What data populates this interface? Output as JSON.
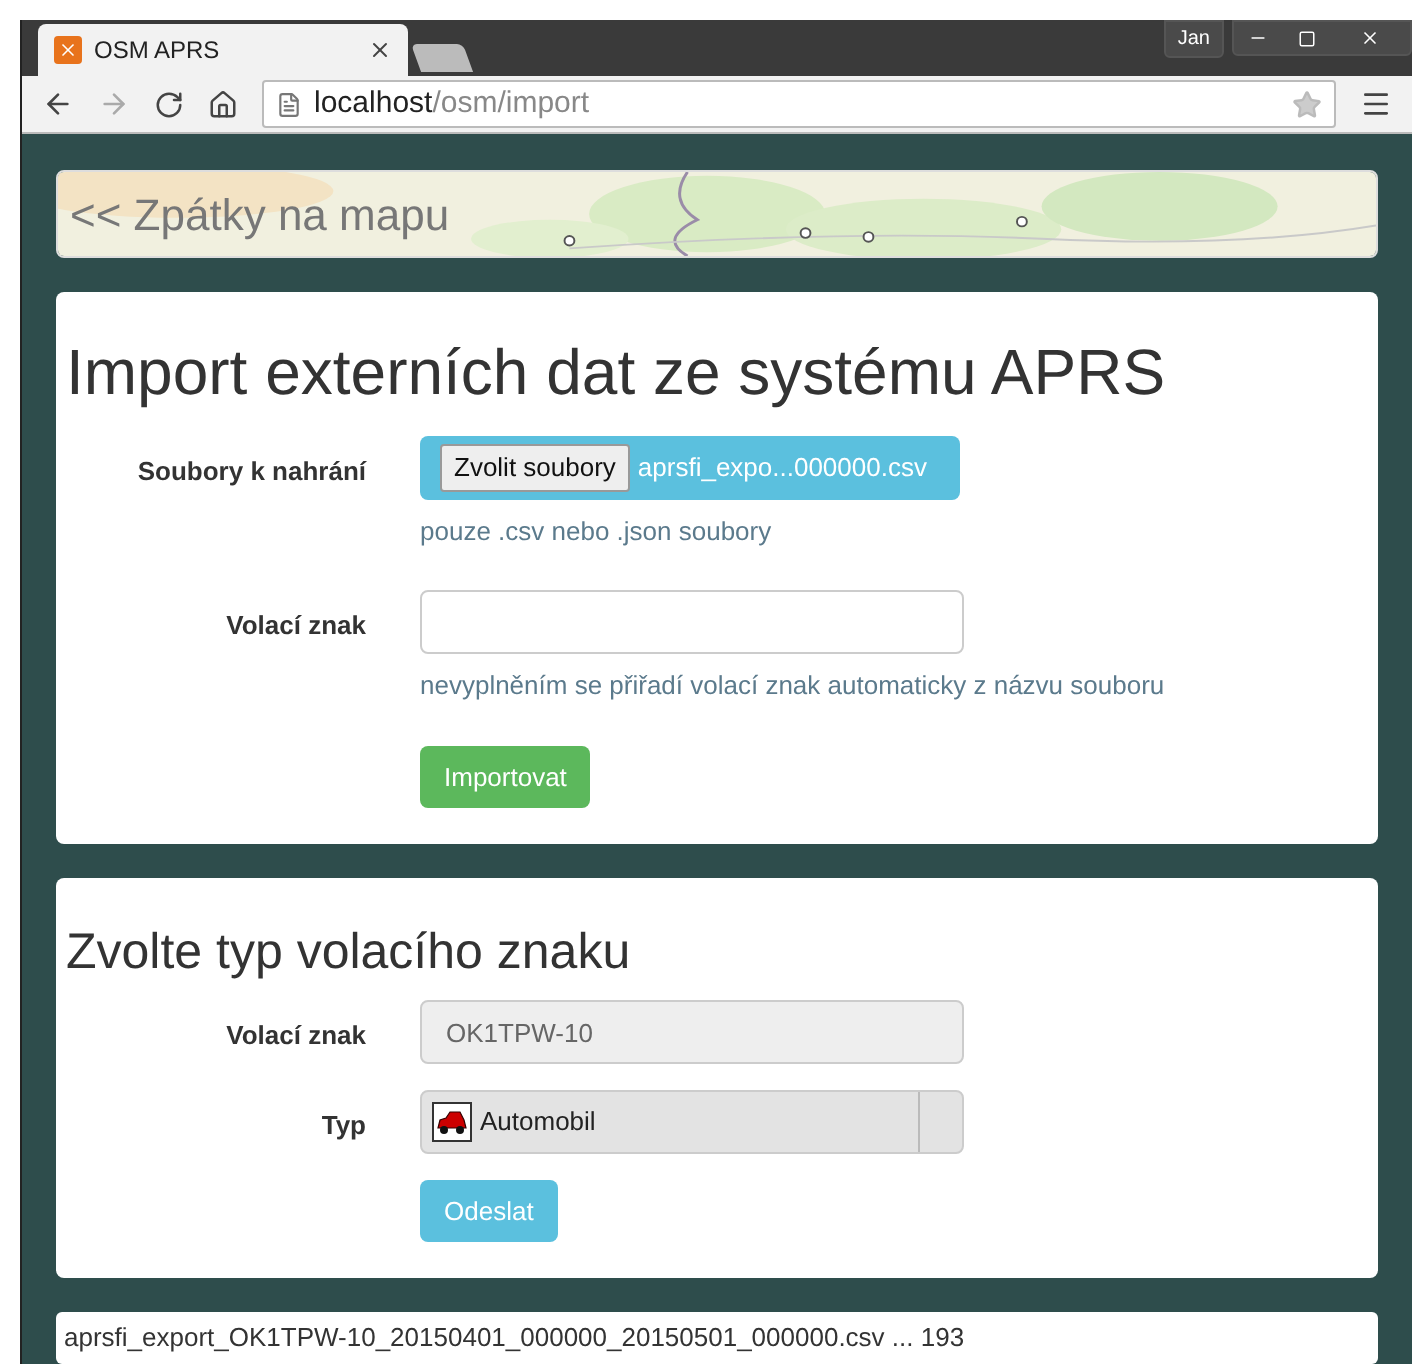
{
  "browser": {
    "user": "Jan",
    "tab": {
      "title": "OSM APRS"
    },
    "url": {
      "host": "localhost",
      "path": "/osm/import"
    }
  },
  "back_link": {
    "text": "<< Zpátky na mapu"
  },
  "import_panel": {
    "title": "Import externích dat ze systému APRS",
    "file_field": {
      "label": "Soubory k nahrání",
      "button": "Zvolit soubory",
      "file_name": "aprsfi_expo...000000.csv",
      "help": "pouze .csv nebo .json soubory"
    },
    "callsign_field": {
      "label": "Volací znak",
      "help": "nevyplněním se přiřadí volací znak automaticky z názvu souboru"
    },
    "submit": "Importovat"
  },
  "type_panel": {
    "title": "Zvolte typ volacího znaku",
    "callsign_field": {
      "label": "Volací znak",
      "value": "OK1TPW-10",
      "disabled": true
    },
    "type_field": {
      "label": "Typ",
      "value": "Automobil"
    },
    "submit": "Odeslat"
  },
  "status": "aprsfi_export_OK1TPW-10_20150401_000000_20150501_000000.csv ... 193"
}
